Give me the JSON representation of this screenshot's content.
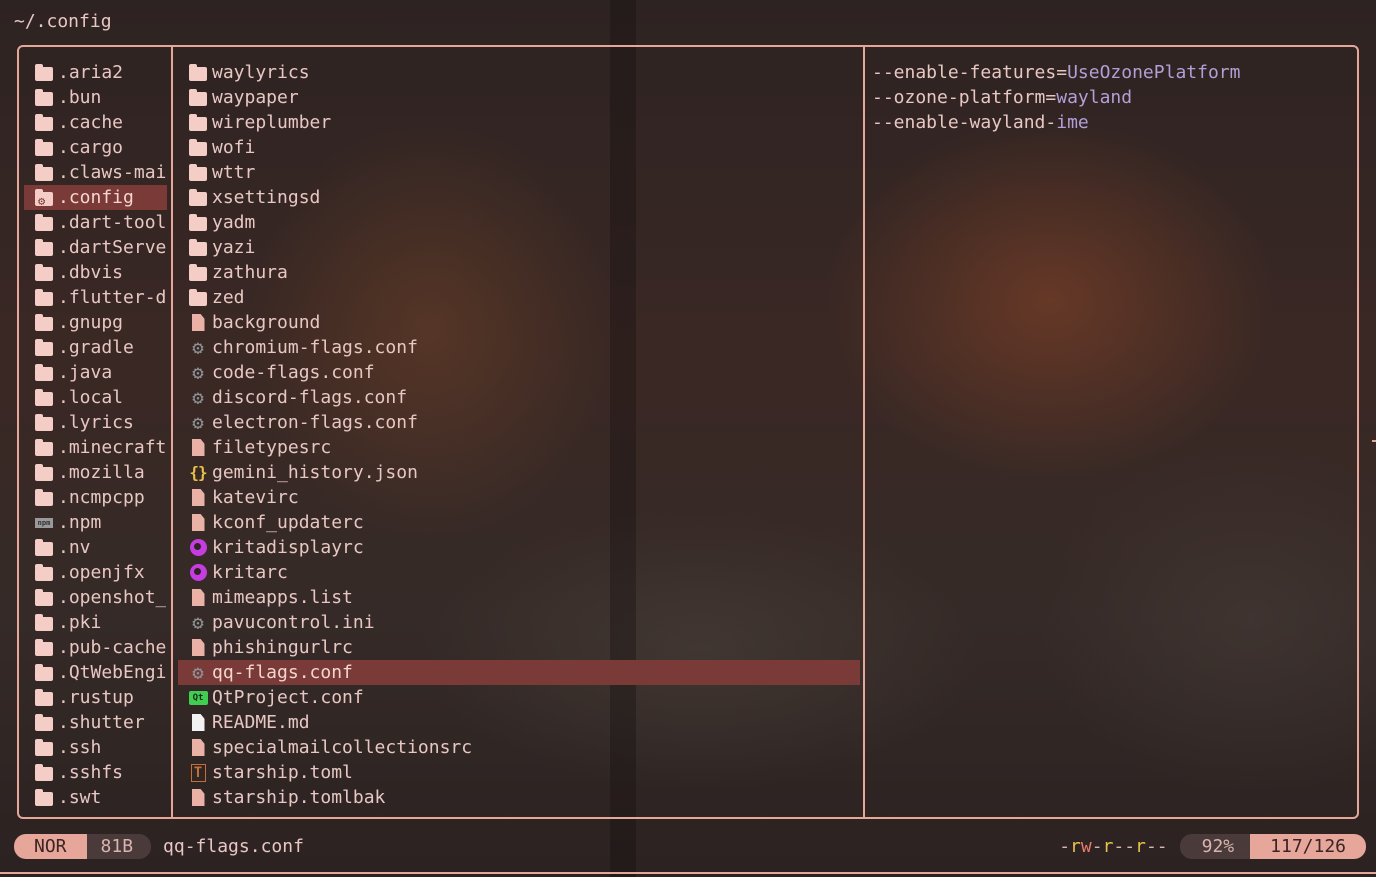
{
  "title": "~/.config",
  "parent_list": [
    {
      "name": ".aria2",
      "icon": "folder-icon"
    },
    {
      "name": ".bun",
      "icon": "folder-icon"
    },
    {
      "name": ".cache",
      "icon": "folder-icon"
    },
    {
      "name": ".cargo",
      "icon": "folder-icon"
    },
    {
      "name": ".claws-mai",
      "icon": "folder-icon"
    },
    {
      "name": ".config",
      "icon": "config-folder-icon",
      "selected": true
    },
    {
      "name": ".dart-tool",
      "icon": "folder-icon"
    },
    {
      "name": ".dartServe",
      "icon": "folder-icon"
    },
    {
      "name": ".dbvis",
      "icon": "folder-icon"
    },
    {
      "name": ".flutter-d",
      "icon": "folder-icon"
    },
    {
      "name": ".gnupg",
      "icon": "folder-icon"
    },
    {
      "name": ".gradle",
      "icon": "folder-icon"
    },
    {
      "name": ".java",
      "icon": "folder-icon"
    },
    {
      "name": ".local",
      "icon": "folder-icon"
    },
    {
      "name": ".lyrics",
      "icon": "folder-icon"
    },
    {
      "name": ".minecraft",
      "icon": "folder-icon"
    },
    {
      "name": ".mozilla",
      "icon": "folder-icon"
    },
    {
      "name": ".ncmpcpp",
      "icon": "folder-icon"
    },
    {
      "name": ".npm",
      "icon": "npm-icon"
    },
    {
      "name": ".nv",
      "icon": "folder-icon"
    },
    {
      "name": ".openjfx",
      "icon": "folder-icon"
    },
    {
      "name": ".openshot_",
      "icon": "folder-icon"
    },
    {
      "name": ".pki",
      "icon": "folder-icon"
    },
    {
      "name": ".pub-cache",
      "icon": "folder-icon"
    },
    {
      "name": ".QtWebEngi",
      "icon": "folder-icon"
    },
    {
      "name": ".rustup",
      "icon": "folder-icon"
    },
    {
      "name": ".shutter",
      "icon": "folder-icon"
    },
    {
      "name": ".ssh",
      "icon": "folder-icon"
    },
    {
      "name": ".sshfs",
      "icon": "folder-icon"
    },
    {
      "name": ".swt",
      "icon": "folder-icon"
    }
  ],
  "current_list": [
    {
      "name": "waylyrics",
      "icon": "folder-icon"
    },
    {
      "name": "waypaper",
      "icon": "folder-icon"
    },
    {
      "name": "wireplumber",
      "icon": "folder-icon"
    },
    {
      "name": "wofi",
      "icon": "folder-icon"
    },
    {
      "name": "wttr",
      "icon": "folder-icon"
    },
    {
      "name": "xsettingsd",
      "icon": "folder-icon"
    },
    {
      "name": "yadm",
      "icon": "folder-icon"
    },
    {
      "name": "yazi",
      "icon": "folder-icon"
    },
    {
      "name": "zathura",
      "icon": "folder-icon"
    },
    {
      "name": "zed",
      "icon": "folder-icon"
    },
    {
      "name": "background",
      "icon": "file-icon"
    },
    {
      "name": "chromium-flags.conf",
      "icon": "gear-icon"
    },
    {
      "name": "code-flags.conf",
      "icon": "gear-icon"
    },
    {
      "name": "discord-flags.conf",
      "icon": "gear-icon"
    },
    {
      "name": "electron-flags.conf",
      "icon": "gear-icon"
    },
    {
      "name": "filetypesrc",
      "icon": "file-icon"
    },
    {
      "name": "gemini_history.json",
      "icon": "json-icon"
    },
    {
      "name": "katevirc",
      "icon": "file-icon"
    },
    {
      "name": "kconf_updaterc",
      "icon": "file-icon"
    },
    {
      "name": "kritadisplayrc",
      "icon": "krita-icon"
    },
    {
      "name": "kritarc",
      "icon": "krita-icon"
    },
    {
      "name": "mimeapps.list",
      "icon": "file-icon"
    },
    {
      "name": "pavucontrol.ini",
      "icon": "gear-icon"
    },
    {
      "name": "phishingurlrc",
      "icon": "file-icon"
    },
    {
      "name": "qq-flags.conf",
      "icon": "gear-icon",
      "selected": true
    },
    {
      "name": "QtProject.conf",
      "icon": "qt-icon"
    },
    {
      "name": "README.md",
      "icon": "markdown-icon"
    },
    {
      "name": "specialmailcollectionsrc",
      "icon": "file-icon"
    },
    {
      "name": "starship.toml",
      "icon": "toml-icon"
    },
    {
      "name": "starship.tomlbak",
      "icon": "file-icon"
    }
  ],
  "preview": [
    {
      "key": "--enable-features=",
      "value": "UseOzonePlatform"
    },
    {
      "key": "--ozone-platform=",
      "value": "wayland"
    },
    {
      "key": "--enable-wayland-",
      "value": "ime"
    }
  ],
  "status": {
    "mode": "NOR",
    "size": "81B",
    "filename": "qq-flags.conf",
    "permissions": "-rw-r--r--",
    "percent": "92%",
    "position": "117/126"
  },
  "colors": {
    "accent": "#e7a69a",
    "selection": "#7a3a37",
    "preview_value": "#b39fd6"
  }
}
